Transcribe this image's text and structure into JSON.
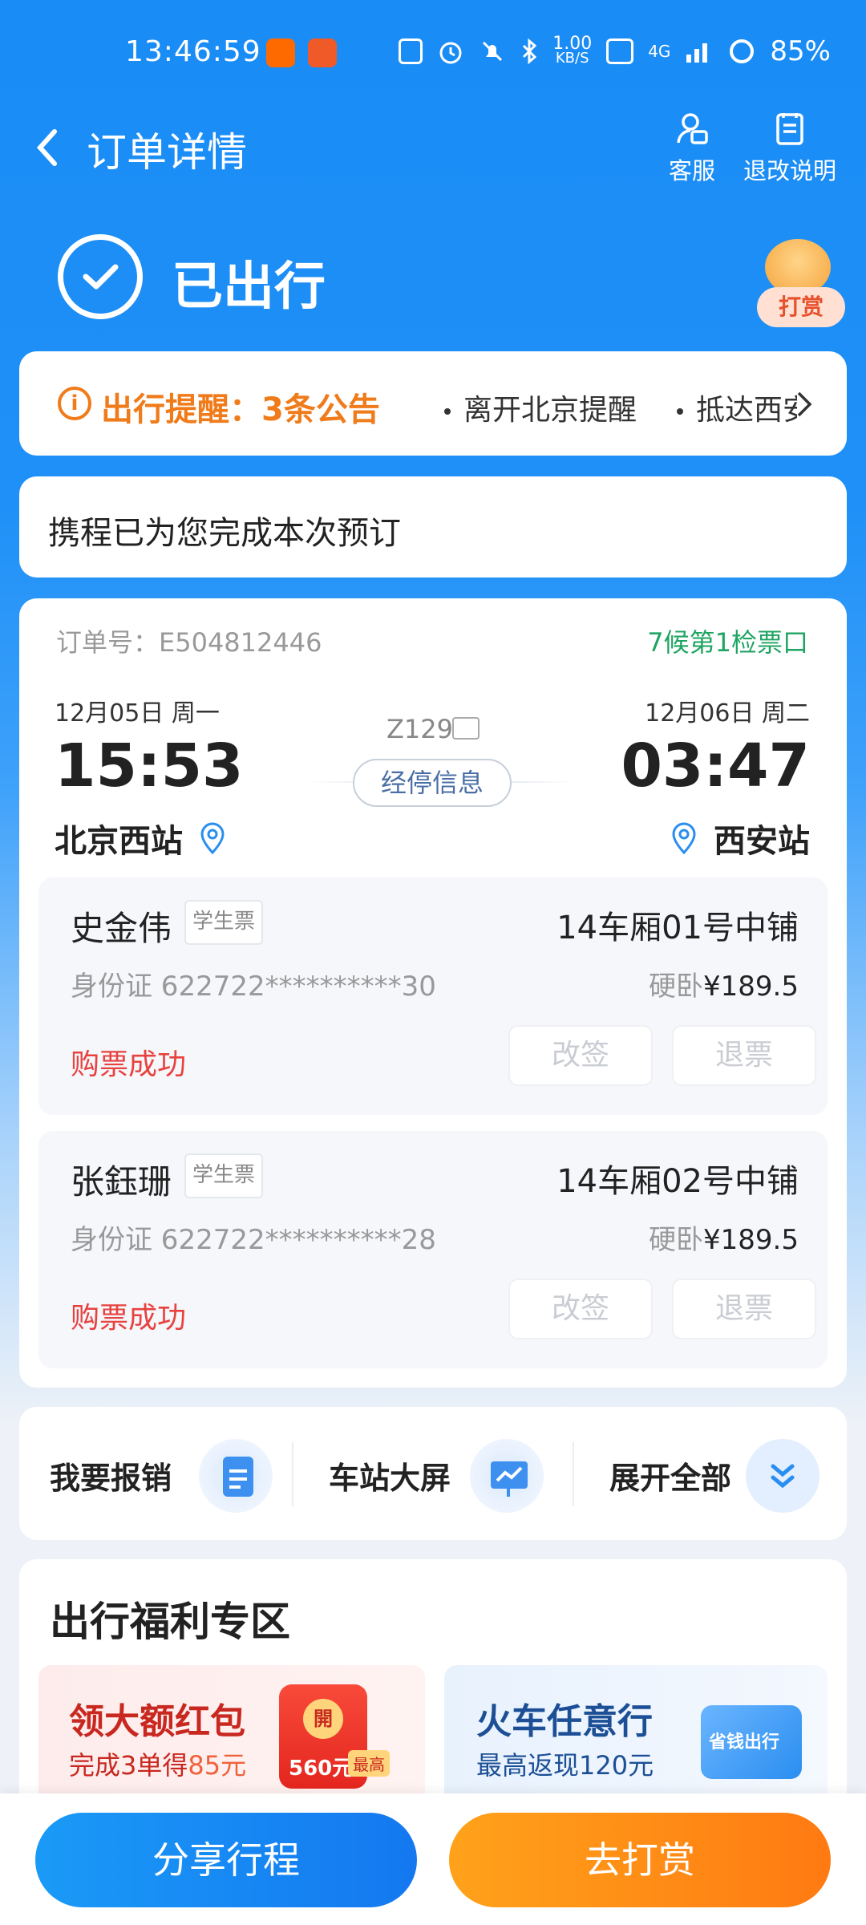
{
  "status_bar": {
    "time": "13:46:59",
    "net_speed_top": "1.00",
    "net_speed_bottom": "KB/S",
    "net_type": "4G",
    "battery": "85%",
    "colors": {
      "tb_app": "#ff6a00",
      "game_app": "#f05a28"
    }
  },
  "nav": {
    "title": "订单详情",
    "service_label": "客服",
    "policy_label": "退改说明"
  },
  "hero": {
    "status": "已出行",
    "tip_label": "打赏"
  },
  "notice": {
    "title": "出行提醒：3条公告",
    "items": [
      "离开北京提醒",
      "抵达西安提醒"
    ]
  },
  "confirm_text": "携程已为您完成本次预订",
  "order": {
    "order_no": "订单号：E504812446",
    "gate": "7候第1检票口",
    "depart": {
      "date": "12月05日  周一",
      "time": "15:53",
      "station": "北京西站"
    },
    "arrive": {
      "date": "12月06日  周二",
      "time": "03:47",
      "station": "西安站"
    },
    "train_no": "Z129",
    "stops_label": "经停信息",
    "passengers": [
      {
        "name": "史金伟",
        "ticket_type": "学生票",
        "seat": "14车厢01号中铺",
        "id_no": "身份证 622722**********30",
        "seat_class": "硬卧",
        "price": "¥189.5",
        "status": "购票成功",
        "change_label": "改签",
        "refund_label": "退票"
      },
      {
        "name": "张鈺珊",
        "ticket_type": "学生票",
        "seat": "14车厢02号中铺",
        "id_no": "身份证 622722**********28",
        "seat_class": "硬卧",
        "price": "¥189.5",
        "status": "购票成功",
        "change_label": "改签",
        "refund_label": "退票"
      }
    ]
  },
  "tools": [
    {
      "label": "我要报销",
      "icon": "reimburse-clipboard-icon"
    },
    {
      "label": "车站大屏",
      "icon": "station-screen-icon"
    },
    {
      "label": "展开全部",
      "icon": "expand-all-chevron-icon"
    }
  ],
  "benefits": {
    "title": "出行福利专区",
    "cards": [
      {
        "heading": "领大额红包",
        "sub_prefix": "完成3单得",
        "sub_amount": "85元",
        "badge_open": "開",
        "badge_amount": "560元",
        "badge_tag": "最高"
      },
      {
        "heading": "火车任意行",
        "sub": "最高返现120元",
        "badge": "省钱出行"
      }
    ]
  },
  "bottom": {
    "share_label": "分享行程",
    "tip_label": "去打赏",
    "colors": {
      "share": "#1a8cf5",
      "tip": "#ff8a12"
    }
  }
}
